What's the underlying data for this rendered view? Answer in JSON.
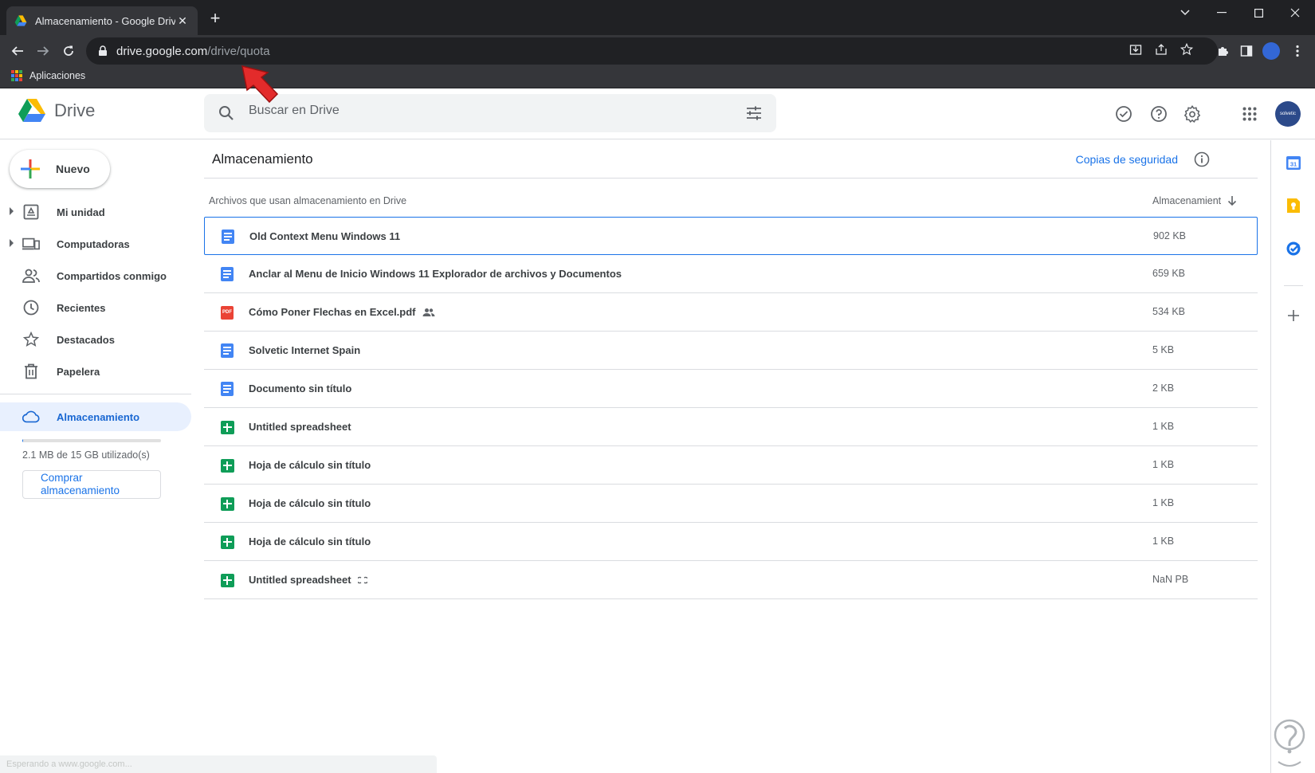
{
  "browser": {
    "tab_title": "Almacenamiento - Google Drive",
    "url_host": "drive.google.com",
    "url_path": "/drive/quota",
    "bookmark_label": "Aplicaciones"
  },
  "header": {
    "logo_text": "Drive",
    "search_placeholder": "Buscar en Drive",
    "avatar_text": "solvetic"
  },
  "sidebar": {
    "new_label": "Nuevo",
    "items": [
      {
        "label": "Mi unidad",
        "icon": "my-drive-icon"
      },
      {
        "label": "Computadoras",
        "icon": "computers-icon"
      },
      {
        "label": "Compartidos conmigo",
        "icon": "shared-icon"
      },
      {
        "label": "Recientes",
        "icon": "clock-icon"
      },
      {
        "label": "Destacados",
        "icon": "star-icon"
      },
      {
        "label": "Papelera",
        "icon": "trash-icon"
      }
    ],
    "storage_label": "Almacenamiento",
    "quota_fraction": 0.00014,
    "quota_text": "2.1 MB de 15 GB utilizado(s)",
    "buy_label": "Comprar almacenamiento"
  },
  "main": {
    "title": "Almacenamiento",
    "backup_link": "Copias de seguridad",
    "col_name": "Archivos que usan almacenamiento en Drive",
    "col_size": "Almacenamient",
    "files": [
      {
        "name": "Old Context Menu Windows 11",
        "size": "902 KB",
        "type": "doc"
      },
      {
        "name": "Anclar al Menu de Inicio Windows 11  Explorador de archivos y Documentos",
        "size": "659 KB",
        "type": "doc"
      },
      {
        "name": "Cómo Poner Flechas en Excel.pdf",
        "size": "534 KB",
        "type": "pdf"
      },
      {
        "name": "Solvetic Internet Spain",
        "size": "5 KB",
        "type": "doc"
      },
      {
        "name": "Documento sin título",
        "size": "2 KB",
        "type": "doc"
      },
      {
        "name": "Untitled spreadsheet",
        "size": "1 KB",
        "type": "sheet"
      },
      {
        "name": "Hoja de cálculo sin título",
        "size": "1 KB",
        "type": "sheet"
      },
      {
        "name": "Hoja de cálculo sin título",
        "size": "1 KB",
        "type": "sheet"
      },
      {
        "name": "Hoja de cálculo sin título",
        "size": "1 KB",
        "type": "sheet"
      },
      {
        "name": "Untitled spreadsheet",
        "size": "NaN PB",
        "type": "sheet"
      }
    ]
  },
  "colors": {
    "accent": "#1a73e8",
    "active_bg": "#e8f0fe",
    "doc": "#4285f4",
    "sheet": "#0f9d58",
    "pdf": "#ea4335"
  },
  "statusbar_text": "Esperando a www.google.com..."
}
